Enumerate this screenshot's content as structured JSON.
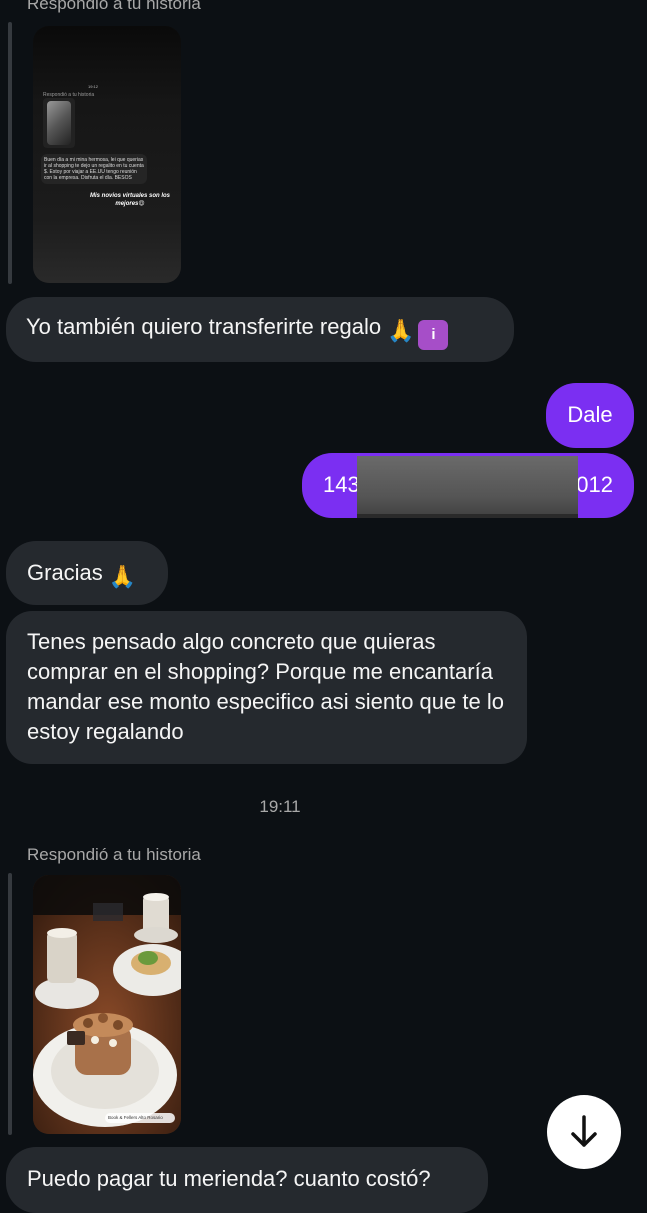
{
  "story_reply_1": {
    "replied_label": "Respondió a tu historia",
    "preview_title": "Respondió a tu historia",
    "preview_message": "Buen día a mi mina hermosa, lei que querias ir al shopping te dejo un regalito en tu cuenta $. Estoy por viajar a EE.UU tengo reunión con la empresa. Disfruta el día. BESOS",
    "preview_caption": "Mis novios virtuales son los mejores😍"
  },
  "messages": {
    "m1": "Yo también quiero transferirte regalo",
    "m1_emoji": "🙏",
    "m1_emoji_box": "i",
    "m2": "Dale",
    "m3_prefix": "143",
    "m3_suffix": "012",
    "m4": "Gracias",
    "m4_emoji": "🙏",
    "m5": "Tenes pensado algo concreto que quieras comprar en el shopping? Porque me encantaría mandar ese monto especifico asi siento que te lo estoy regalando",
    "m6": "Puedo pagar tu merienda? cuanto costó?"
  },
  "timestamp": "19:11",
  "story_reply_2": {
    "replied_label": "Respondió a tu historia",
    "location_tag": "Book & Fellers Alto Rosario"
  },
  "colors": {
    "background": "#0c1014",
    "incoming_bubble": "#25292e",
    "outgoing_bubble": "#7b2ff2"
  }
}
